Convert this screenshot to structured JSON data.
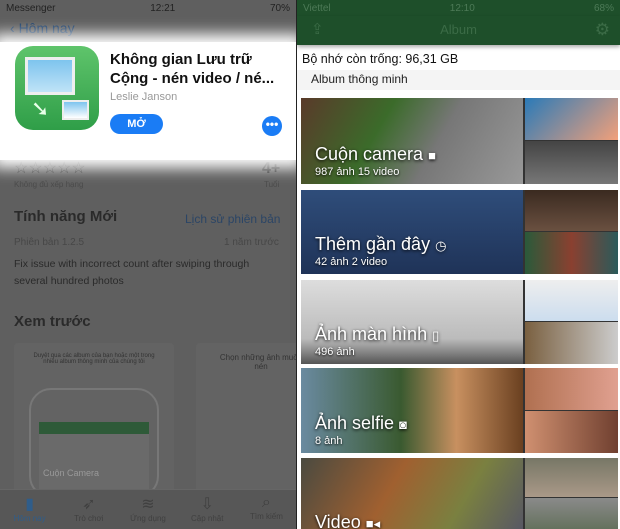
{
  "left": {
    "status": {
      "carrier": "Messenger",
      "time": "12:21",
      "battery": "70%"
    },
    "back": "Hôm nay",
    "app": {
      "title": "Không gian Lưu trữ Cộng - nén video / né...",
      "developer": "Leslie Janson",
      "open_label": "MỞ",
      "more_label": "•••"
    },
    "rating": {
      "stars": "☆☆☆☆☆",
      "text": "Không đủ xếp hạng",
      "age": "4+",
      "age_label": "Tuổi"
    },
    "whats_new": {
      "title": "Tính năng Mới",
      "history": "Lịch sử phiên bản",
      "version": "Phiên bản 1.2.5",
      "when": "1 năm trước",
      "notes": "Fix issue with incorrect count after swiping through several hundred photos"
    },
    "preview": {
      "title": "Xem trước",
      "captions": [
        "Duyệt qua các album của bạn hoặc một trong nhiều album thông minh của chúng tôi",
        "Chọn những ảnh muốn nén"
      ],
      "inner_album": "Cuộn Camera"
    },
    "tabs": [
      {
        "label": "Hôm nay",
        "icon": "today-icon"
      },
      {
        "label": "Trò chơi",
        "icon": "rocket-icon"
      },
      {
        "label": "Ứng dụng",
        "icon": "layers-icon"
      },
      {
        "label": "Cập nhật",
        "icon": "download-icon"
      },
      {
        "label": "Tìm kiếm",
        "icon": "search-icon"
      }
    ]
  },
  "right": {
    "status": {
      "carrier": "Viettel",
      "time": "12:10",
      "battery": "68%"
    },
    "nav_title": "Album",
    "free_space": "Bộ nhớ còn trống: 96,31 GB",
    "section": "Album thông minh",
    "albums": [
      {
        "name": "Cuộn camera",
        "icon": "■",
        "counts": "987 ảnh    15 video"
      },
      {
        "name": "Thêm gần đây",
        "icon": "◷",
        "counts": "42 ảnh    2 video"
      },
      {
        "name": "Ảnh màn hình",
        "icon": "▯",
        "counts": "496 ảnh"
      },
      {
        "name": "Ảnh selfie",
        "icon": "◙",
        "counts": "8 ảnh"
      },
      {
        "name": "Video",
        "icon": "■◂",
        "counts": ""
      }
    ]
  }
}
